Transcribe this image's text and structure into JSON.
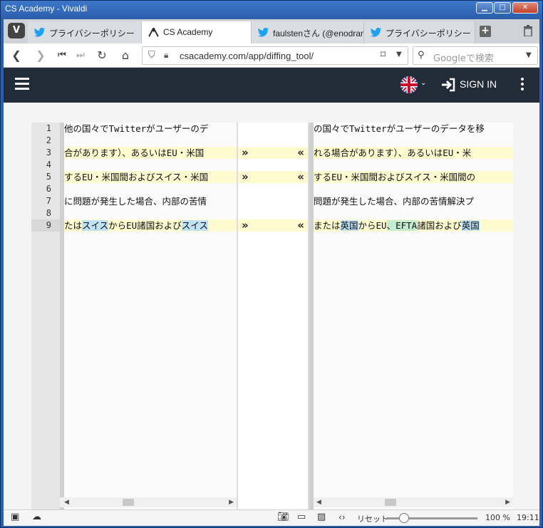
{
  "window": {
    "title": "CS Academy - Vivaldi"
  },
  "tabs": [
    {
      "label": "プライバシーポリシー",
      "icon": "twitter-icon"
    },
    {
      "label": "CS Academy",
      "icon": "csacademy-icon"
    },
    {
      "label": "faulstenさん (@enodran",
      "icon": "twitter-icon"
    },
    {
      "label": "プライバシーポリシー",
      "icon": "twitter-icon"
    }
  ],
  "address": {
    "url": "csacademy.com/app/diffing_tool/"
  },
  "search": {
    "placeholder": "Googleで検索"
  },
  "header": {
    "signin": "SIGN IN"
  },
  "diff": {
    "left_lines": [
      {
        "num": "1",
        "text": "他の国々でTwitterがユーザーのデ"
      },
      {
        "num": "2",
        "text": ""
      },
      {
        "num": "3",
        "text": "合があります）、あるいはEU・米国"
      },
      {
        "num": "4",
        "text": ""
      },
      {
        "num": "5",
        "text": "するEU・米国間およびスイス・米国"
      },
      {
        "num": "6",
        "text": ""
      },
      {
        "num": "7",
        "text": "に問題が発生した場合、内部の苦情"
      },
      {
        "num": "8",
        "text": ""
      },
      {
        "num": "9",
        "text": ""
      }
    ],
    "left_line9": {
      "p1": "たは",
      "b1": "スイス",
      "p2": "からEU諸国および",
      "b2": "スイス"
    },
    "right_lines": [
      "の国々でTwitterがユーザーのデータを移",
      "",
      "れる場合があります）、あるいはEU・米",
      "",
      "するEU・米国間およびスイス・米国間の",
      "",
      "問題が発生した場合、内部の苦情解決プ",
      "",
      ""
    ],
    "right_line9": {
      "p1": "または",
      "b1": "英国",
      "p2": "からEU",
      "g1": "、EFTA",
      "p3": "諸国および",
      "b2": "英国"
    },
    "arrow_right": "»",
    "arrow_left": "«"
  },
  "status": {
    "reset": "リセット",
    "zoom": "100 %",
    "time": "19:11",
    "zoom_level": 0.2
  },
  "colors": {
    "chrome_blue": "#2d5fa8",
    "header_dark": "#222c38",
    "changed_line": "#fffbd1",
    "changed_word": "#bfe2f6",
    "added_word": "#c4ecd0"
  }
}
